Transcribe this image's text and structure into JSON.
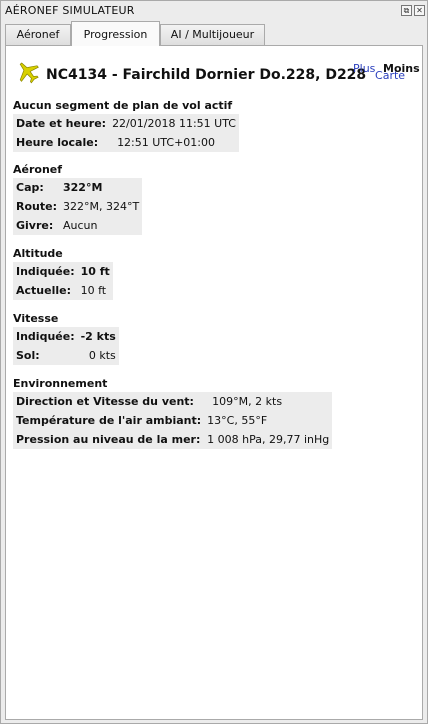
{
  "window": {
    "title": "AÉRONEF SIMULATEUR"
  },
  "tabs": [
    {
      "label": "Aéronef"
    },
    {
      "label": "Progression"
    },
    {
      "label": "AI / Multijoueur"
    }
  ],
  "header": {
    "aircraft": "NC4134 - Fairchild Dornier Do.228, D228",
    "map_link": "Carte",
    "plus": "Plus",
    "moins": "Moins"
  },
  "flight_plan": {
    "title": "Aucun segment de plan de vol actif",
    "rows": [
      {
        "k": "Date et heure:",
        "v": "22/01/2018 11:51 UTC"
      },
      {
        "k": "Heure locale:",
        "v": "12:51 UTC+01:00"
      }
    ]
  },
  "aircraft_section": {
    "title": "Aéronef",
    "rows": [
      {
        "k": "Cap:",
        "v": "322°M"
      },
      {
        "k": "Route:",
        "v": "322°M, 324°T"
      },
      {
        "k": "Givre:",
        "v": "Aucun"
      }
    ]
  },
  "altitude": {
    "title": "Altitude",
    "rows": [
      {
        "k": "Indiquée:",
        "v": "10 ft"
      },
      {
        "k": "Actuelle:",
        "v": "10 ft"
      }
    ]
  },
  "speed": {
    "title": "Vitesse",
    "rows": [
      {
        "k": "Indiquée:",
        "v": "-2 kts"
      },
      {
        "k": "Sol:",
        "v": "0 kts"
      }
    ]
  },
  "environment": {
    "title": "Environnement",
    "rows": [
      {
        "k": "Direction et Vitesse du vent:",
        "v": "109°M, 2 kts"
      },
      {
        "k": "Température de l'air ambiant:",
        "v": "13°C, 55°F"
      },
      {
        "k": "Pression au niveau de la mer:",
        "v": "1 008 hPa, 29,77 inHg"
      }
    ]
  },
  "colors": {
    "link": "#2a3fbd",
    "row_shade": "#ececec",
    "plane": "#d8d000"
  }
}
